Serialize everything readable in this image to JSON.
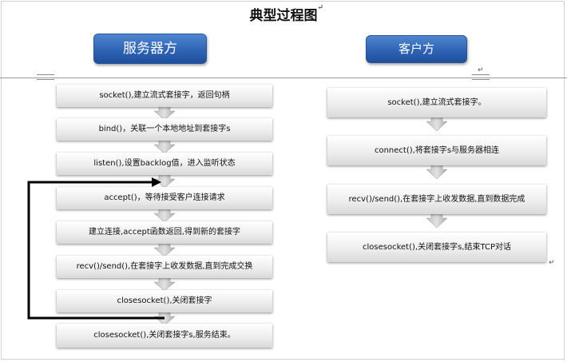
{
  "title": "典型过程图",
  "server": {
    "header": "服务器方",
    "steps": [
      "socket(),建立流式套接字，返回句柄",
      "bind()，关联一个本地地址到套接字s",
      "listen(),设置backlog值，进入监听状态",
      "accept()，等待接受客户连接请求",
      "建立连接,accept函数返回,得到新的套接字",
      "recv()/send(),在套接字上收发数据,直到完成交换",
      "closesocket(),关闭套接字",
      "closesocket(),关闭套接字s,服务结束。"
    ]
  },
  "client": {
    "header": "客户方",
    "steps": [
      "socket(),建立流式套接字。",
      "connect(),将套接字s与服务器相连",
      "recv()/send(),在套接字上收发数据,直到数据完成",
      "closesocket(),关闭套接字s,结束TCP对话"
    ]
  },
  "colors": {
    "header_blue": "#2f63b4",
    "step_gray": "#e6e6e6",
    "loop_arrow": "#000000"
  }
}
